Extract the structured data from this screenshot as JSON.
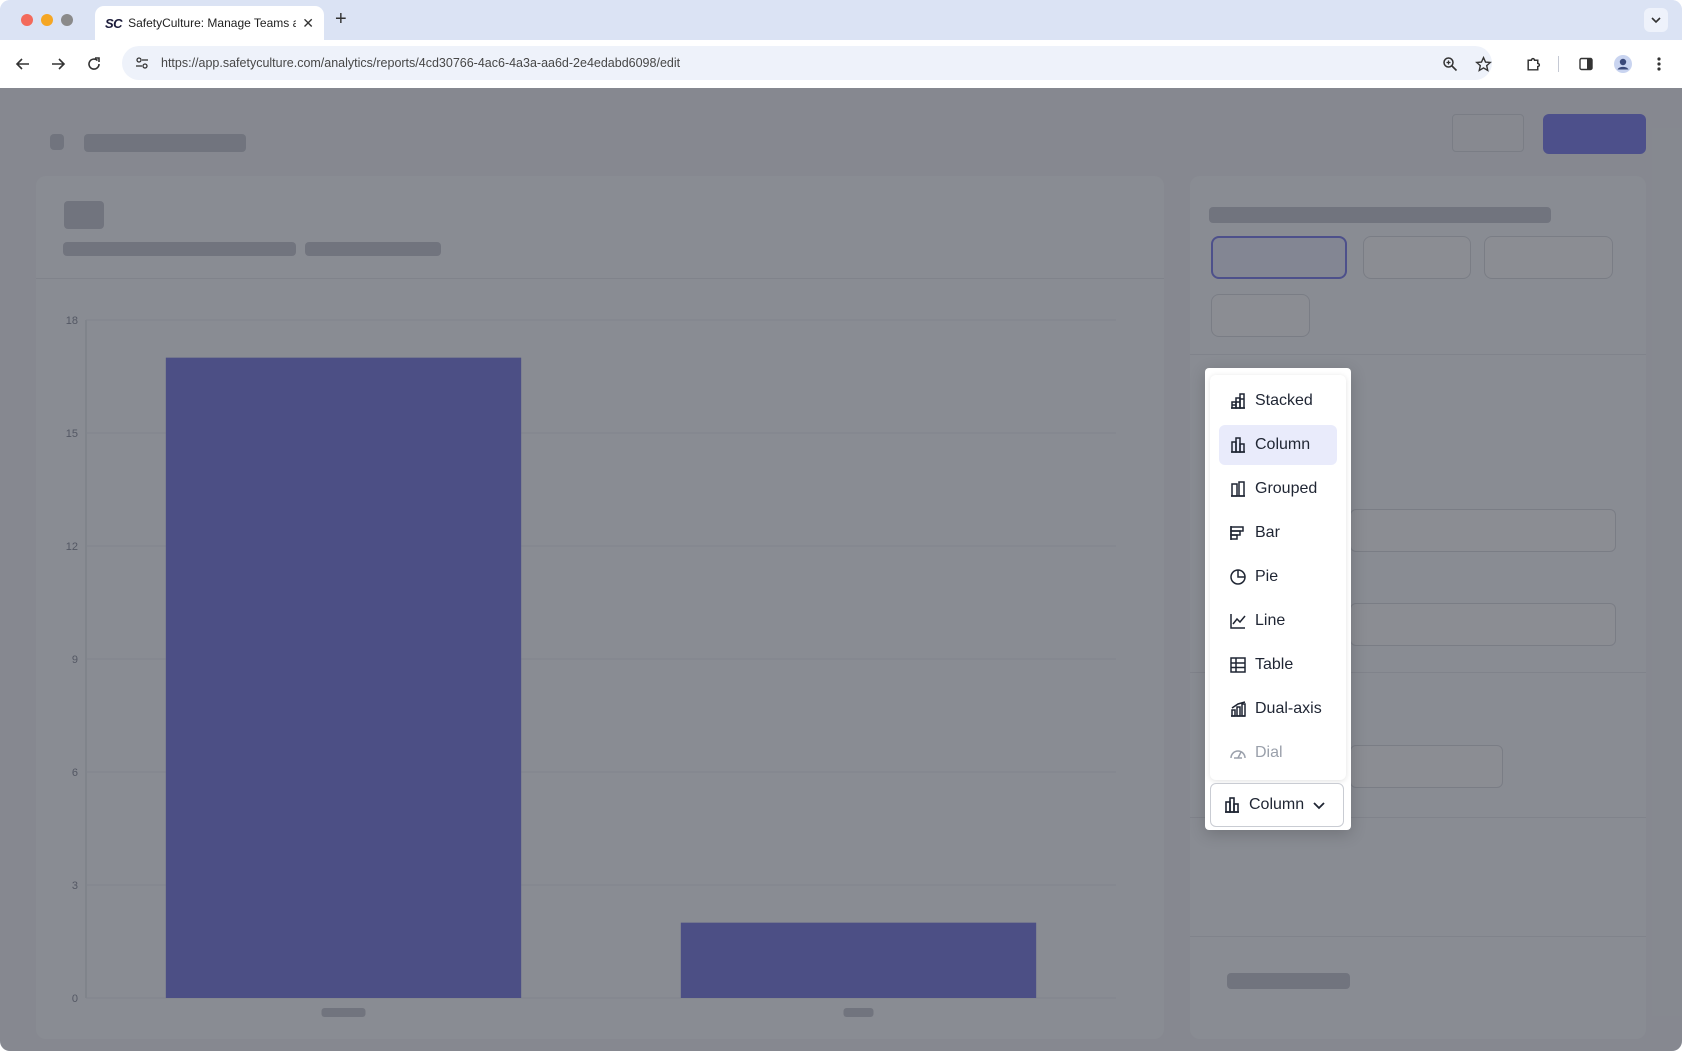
{
  "browser": {
    "tab_title": "SafetyCulture: Manage Teams and...",
    "tab_logo": "SC",
    "url": "https://app.safetyculture.com/analytics/reports/4cd30766-4ac6-4a3a-aa6d-2e4edabd6098/edit",
    "icons": {
      "back": "arrow-left-icon",
      "forward": "arrow-right-icon",
      "reload": "reload-icon",
      "site_info": "tune-icon",
      "zoom": "zoom-icon",
      "bookmark": "star-icon",
      "extensions": "puzzle-icon",
      "side_panel": "side-panel-icon",
      "profile": "profile-icon",
      "menu": "kebab-icon"
    }
  },
  "colors": {
    "accent": "#5b5ce6",
    "bar_color": "#5759d8",
    "selected_bg": "#e9ebfb"
  },
  "chart_type_menu": {
    "items": [
      {
        "label": "Stacked",
        "icon": "stacked-chart-icon",
        "selected": false,
        "disabled": false
      },
      {
        "label": "Column",
        "icon": "column-chart-icon",
        "selected": true,
        "disabled": false
      },
      {
        "label": "Grouped",
        "icon": "grouped-chart-icon",
        "selected": false,
        "disabled": false
      },
      {
        "label": "Bar",
        "icon": "bar-chart-icon",
        "selected": false,
        "disabled": false
      },
      {
        "label": "Pie",
        "icon": "pie-chart-icon",
        "selected": false,
        "disabled": false
      },
      {
        "label": "Line",
        "icon": "line-chart-icon",
        "selected": false,
        "disabled": false
      },
      {
        "label": "Table",
        "icon": "table-icon",
        "selected": false,
        "disabled": false
      },
      {
        "label": "Dual-axis",
        "icon": "dual-axis-chart-icon",
        "selected": false,
        "disabled": false
      },
      {
        "label": "Dial",
        "icon": "dial-icon",
        "selected": false,
        "disabled": true
      }
    ],
    "selected_label": "Column",
    "selected_icon": "column-chart-icon"
  },
  "chart_data": {
    "type": "bar",
    "categories": [
      "",
      ""
    ],
    "values": [
      17,
      2
    ],
    "ylim": [
      0,
      18
    ],
    "y_ticks": [
      "0",
      "3",
      "6",
      "9",
      "12",
      "15",
      "18"
    ],
    "grid": true
  }
}
